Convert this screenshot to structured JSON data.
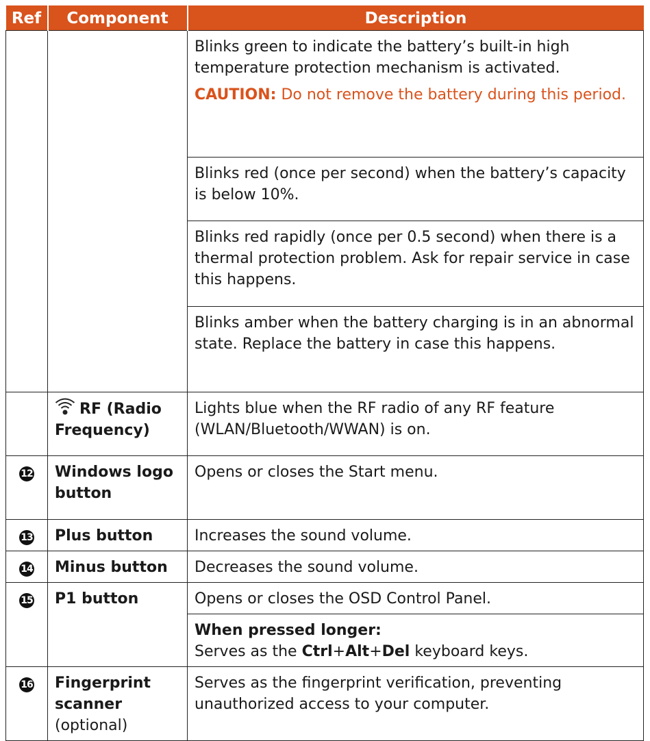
{
  "header": {
    "ref": "Ref",
    "component": "Component",
    "description": "Description"
  },
  "rows": {
    "r1": {
      "desc": "Blinks green to indicate the battery’s built-in high temperature protection mechanism is activated.",
      "caution_label": "CAUTION:",
      "caution_text": " Do not remove the battery during this period."
    },
    "r2": {
      "desc": "Blinks red (once per second) when the battery’s capacity is below 10%."
    },
    "r3": {
      "desc": "Blinks red rapidly (once per 0.5 second) when there is a thermal protection problem. Ask for repair service in case this happens."
    },
    "r4": {
      "desc": "Blinks amber when the battery charging is in an abnormal state. Replace the battery in case this happens."
    },
    "rf": {
      "icon": "wireless-signal-icon",
      "component": "RF (Radio Frequency)",
      "desc": "Lights blue when the RF radio of any RF feature (WLAN/Bluetooth/WWAN) is on."
    },
    "r12": {
      "ref": "12",
      "component": "Windows logo button",
      "desc": "Opens or closes the Start menu."
    },
    "r13": {
      "ref": "13",
      "component": "Plus button",
      "desc": "Increases the sound volume."
    },
    "r14": {
      "ref": "14",
      "component": "Minus button",
      "desc": "Decreases the sound volume."
    },
    "r15": {
      "ref": "15",
      "component": "P1 button",
      "desc": "Opens or closes the OSD Control Panel.",
      "longer_label": "When pressed longer:",
      "longer_prefix": "Serves as the ",
      "key1": "Ctrl",
      "plus1": "+",
      "key2": "Alt",
      "plus2": "+",
      "key3": "Del",
      "longer_suffix": " keyboard keys."
    },
    "r16": {
      "ref": "16",
      "component": "Fingerprint scanner",
      "component_note": "(optional)",
      "desc": "Serves as the fingerprint verification, preventing unauthorized access to your computer."
    }
  },
  "colors": {
    "header_bg": "#d9531c",
    "caution": "#d9531c"
  }
}
